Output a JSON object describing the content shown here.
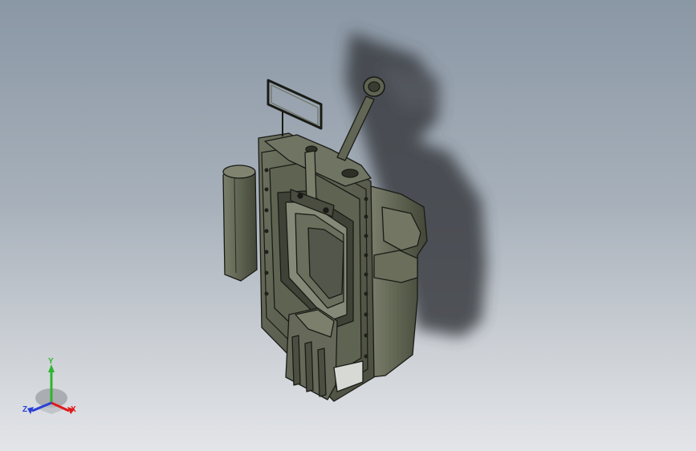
{
  "viewport": {
    "background_top": "#8a97a5",
    "background_bottom": "#e3e5e8"
  },
  "model": {
    "body_color": "#5b5f4f",
    "edge_color": "#1a1b16",
    "shadow_color": "#3c3f44"
  },
  "triad": {
    "x_label": "X",
    "y_label": "Y",
    "z_label": "Z",
    "x_color": "#e01a1a",
    "y_color": "#2fb52f",
    "z_color": "#2a3fd6"
  }
}
